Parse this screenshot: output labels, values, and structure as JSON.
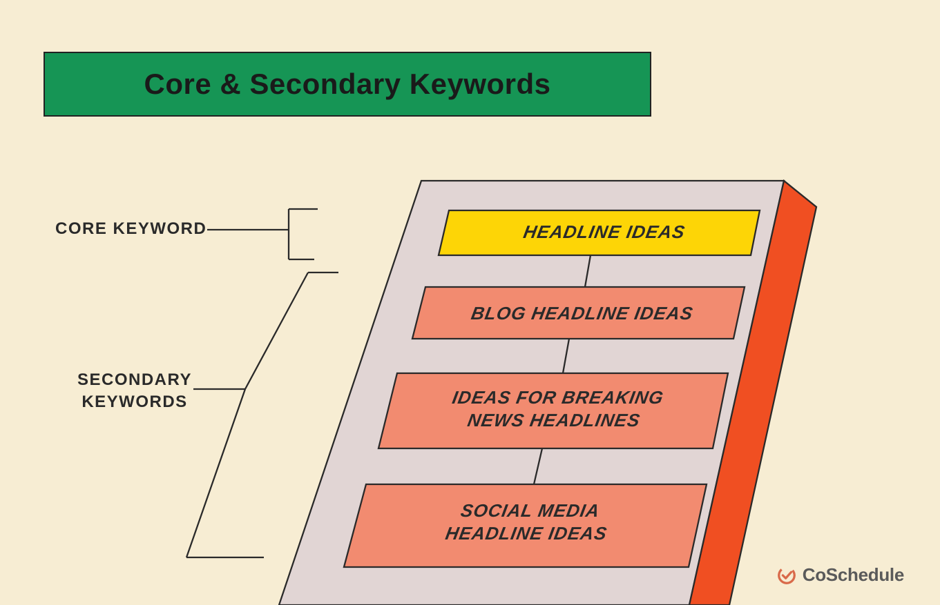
{
  "title": "Core & Secondary Keywords",
  "labels": {
    "core": "CORE KEYWORD",
    "secondary": "SECONDARY\nKEYWORDS"
  },
  "cards": {
    "headline": "HEADLINE IDEAS",
    "blog": "BLOG HEADLINE IDEAS",
    "breaking": "IDEAS FOR BREAKING\nNEWS HEADLINES",
    "social": "SOCIAL MEDIA\nHEADLINE IDEAS"
  },
  "brand": "CoSchedule",
  "colors": {
    "bg": "#f7edd3",
    "green": "#169555",
    "yellow": "#fdd506",
    "salmon": "#f28b70",
    "orange": "#f04f22",
    "panel": "#e1d5d4",
    "stroke": "#2a2a2a"
  }
}
